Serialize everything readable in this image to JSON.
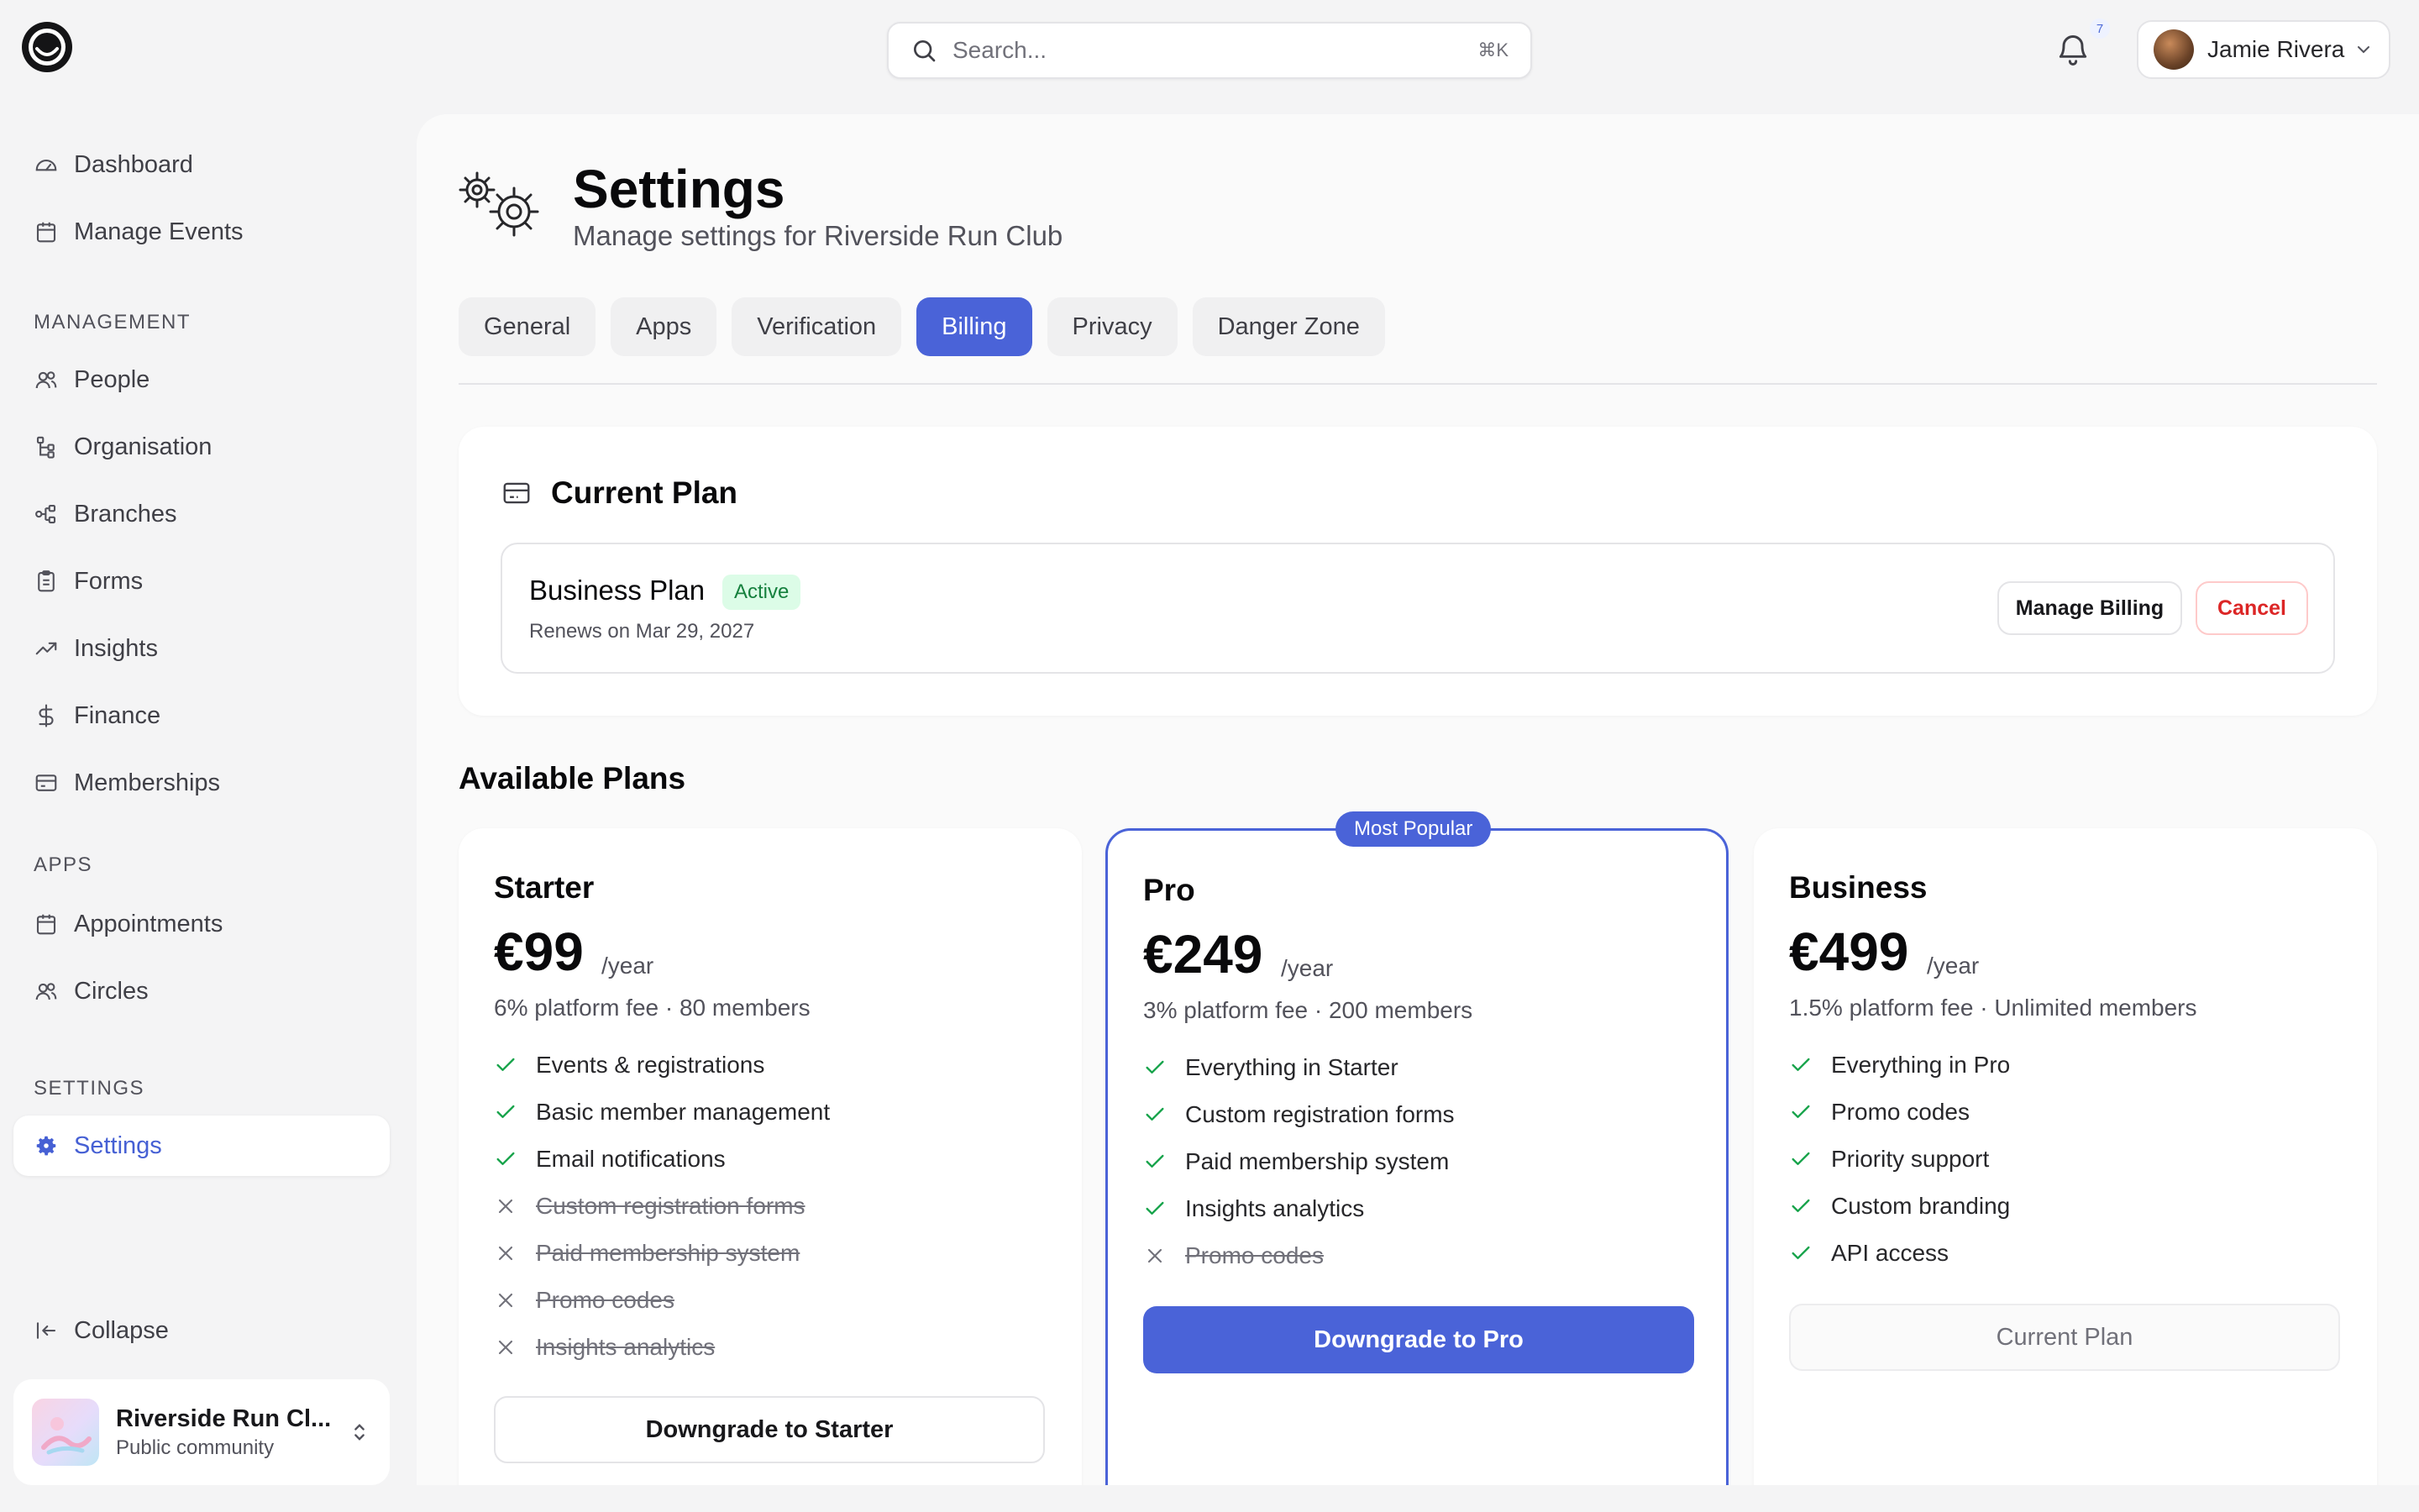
{
  "app": {
    "logo_icon": "eye-logo-icon"
  },
  "search": {
    "placeholder": "Search...",
    "shortcut": "⌘K"
  },
  "notifications": {
    "count": "7"
  },
  "user": {
    "name": "Jamie Rivera"
  },
  "sidebar": {
    "top_items": [
      {
        "label": "Dashboard",
        "icon": "gauge-icon"
      },
      {
        "label": "Manage Events",
        "icon": "calendar-icon"
      }
    ],
    "sections": [
      {
        "title": "MANAGEMENT",
        "items": [
          {
            "label": "People",
            "icon": "users-icon"
          },
          {
            "label": "Organisation",
            "icon": "hierarchy-icon"
          },
          {
            "label": "Branches",
            "icon": "branches-icon"
          },
          {
            "label": "Forms",
            "icon": "clipboard-icon"
          },
          {
            "label": "Insights",
            "icon": "trend-icon"
          },
          {
            "label": "Finance",
            "icon": "dollar-icon"
          },
          {
            "label": "Memberships",
            "icon": "card-icon"
          }
        ]
      },
      {
        "title": "APPS",
        "items": [
          {
            "label": "Appointments",
            "icon": "calendar-icon"
          },
          {
            "label": "Circles",
            "icon": "users-icon"
          }
        ]
      },
      {
        "title": "SETTINGS",
        "items": [
          {
            "label": "Settings",
            "icon": "gear-icon",
            "active": true
          }
        ]
      }
    ],
    "collapse_label": "Collapse",
    "org": {
      "name": "Riverside Run Cl...",
      "type": "Public community"
    }
  },
  "page": {
    "title": "Settings",
    "subtitle": "Manage settings for Riverside Run Club",
    "tabs": [
      "General",
      "Apps",
      "Verification",
      "Billing",
      "Privacy",
      "Danger Zone"
    ],
    "active_tab": "Billing"
  },
  "current_plan": {
    "heading": "Current Plan",
    "plan_name": "Business Plan",
    "status": "Active",
    "renews": "Renews on Mar 29, 2027",
    "manage_label": "Manage Billing",
    "cancel_label": "Cancel"
  },
  "available_plans": {
    "heading": "Available Plans",
    "popular_badge": "Most Popular",
    "plans": [
      {
        "name": "Starter",
        "price": "€99",
        "period": "/year",
        "fee": "6% platform fee · 80 members",
        "features": [
          {
            "label": "Events & registrations",
            "included": true
          },
          {
            "label": "Basic member management",
            "included": true
          },
          {
            "label": "Email notifications",
            "included": true
          },
          {
            "label": "Custom registration forms",
            "included": false
          },
          {
            "label": "Paid membership system",
            "included": false
          },
          {
            "label": "Promo codes",
            "included": false
          },
          {
            "label": "Insights analytics",
            "included": false
          }
        ],
        "cta": "Downgrade to Starter"
      },
      {
        "name": "Pro",
        "price": "€249",
        "period": "/year",
        "fee": "3% platform fee · 200 members",
        "features": [
          {
            "label": "Everything in Starter",
            "included": true
          },
          {
            "label": "Custom registration forms",
            "included": true
          },
          {
            "label": "Paid membership system",
            "included": true
          },
          {
            "label": "Insights analytics",
            "included": true
          },
          {
            "label": "Promo codes",
            "included": false
          }
        ],
        "cta": "Downgrade to Pro"
      },
      {
        "name": "Business",
        "price": "€499",
        "period": "/year",
        "fee": "1.5% platform fee · Unlimited members",
        "features": [
          {
            "label": "Everything in Pro",
            "included": true
          },
          {
            "label": "Promo codes",
            "included": true
          },
          {
            "label": "Priority support",
            "included": true
          },
          {
            "label": "Custom branding",
            "included": true
          },
          {
            "label": "API access",
            "included": true
          }
        ],
        "cta": "Current Plan"
      }
    ]
  },
  "colors": {
    "accent": "#4a63d8",
    "active_badge_bg": "#dcfce7",
    "active_badge_text": "#15803d",
    "danger": "#dc2626"
  }
}
